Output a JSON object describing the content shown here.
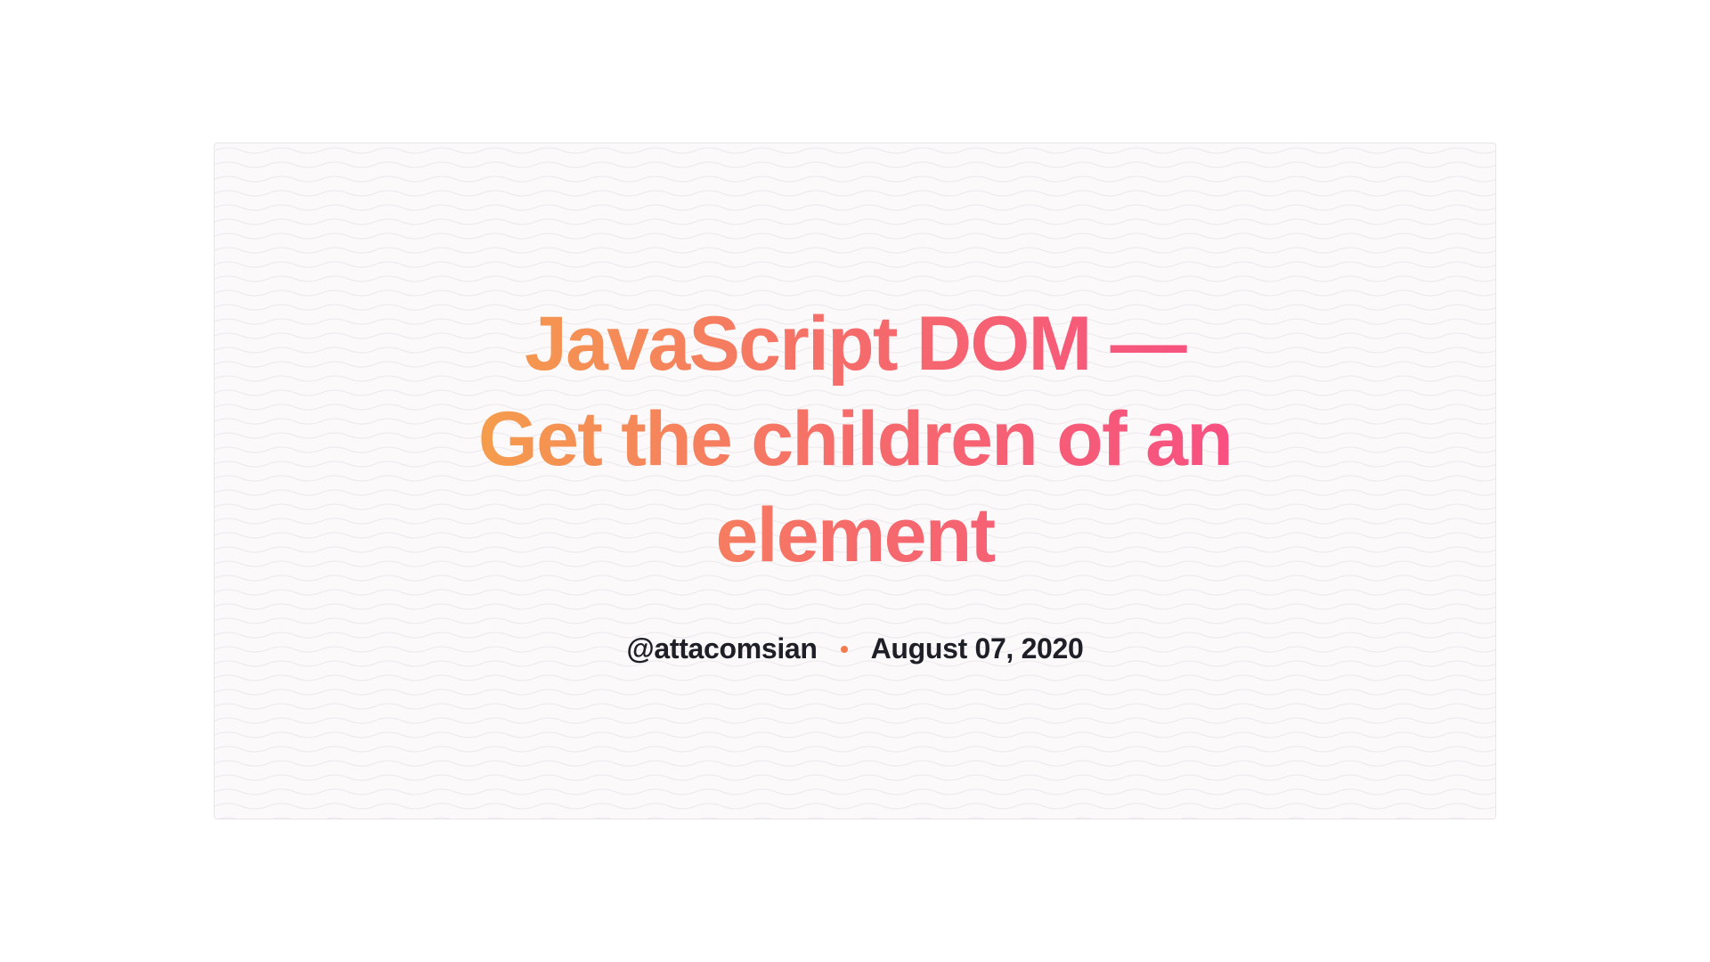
{
  "card": {
    "title": "JavaScript DOM — Get the children of an element",
    "author_handle": "@attacomsian",
    "date": "August 07, 2020"
  },
  "colors": {
    "gradient_start": "#f5a04a",
    "gradient_mid": "#f56b6b",
    "gradient_end": "#f74e83",
    "dot": "#f27b50",
    "text": "#1f1f27",
    "card_bg": "#fbf9fa"
  }
}
